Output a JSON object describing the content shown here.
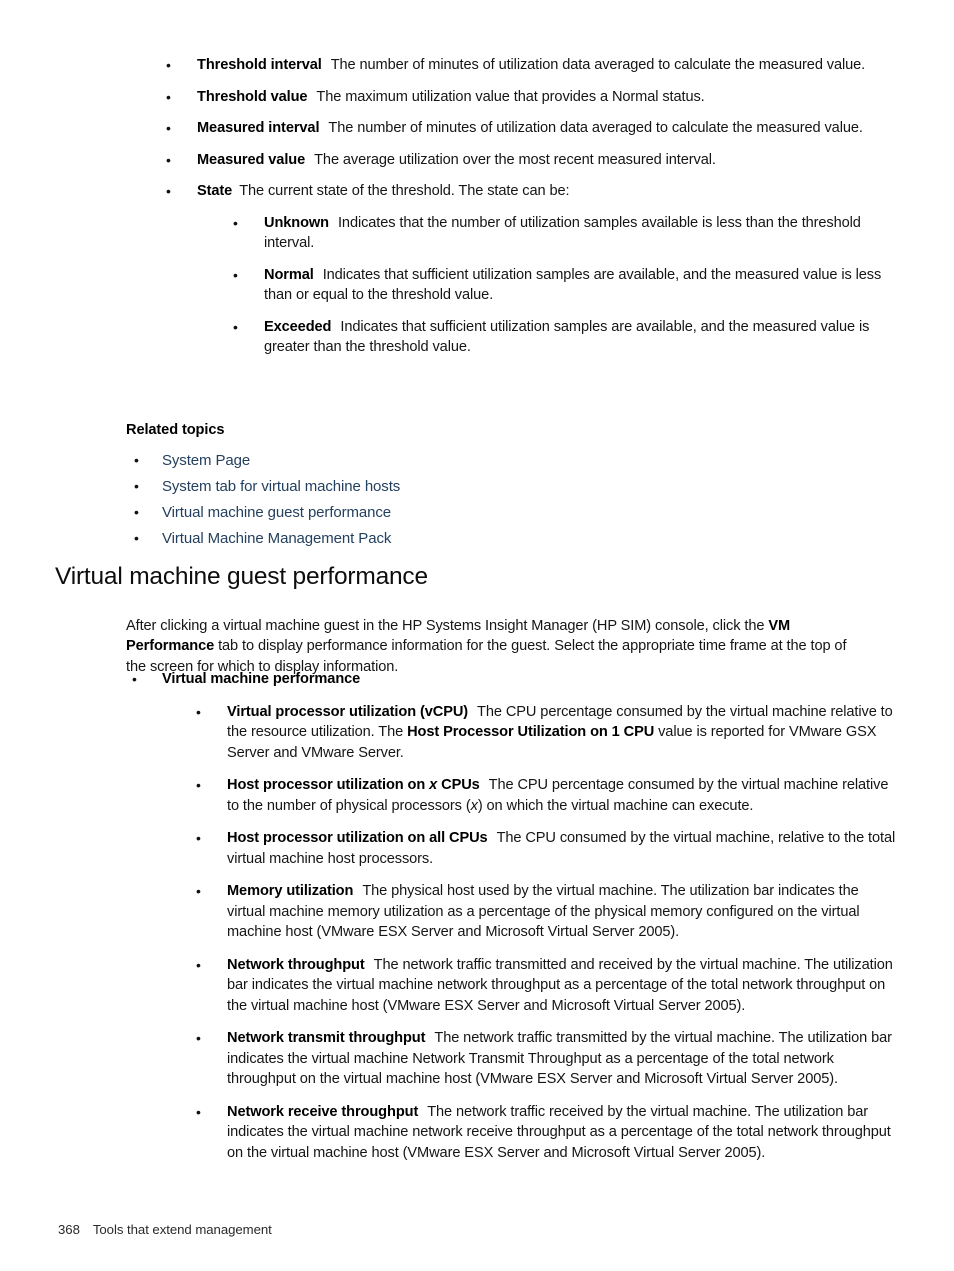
{
  "page": {
    "footer_page_number": "368",
    "footer_title": "Tools that extend management",
    "link_color": "#24405f",
    "text_color": "#151515",
    "bullet_glyph": "•"
  },
  "threshold_items": [
    {
      "term": "Threshold interval",
      "desc": "The number of minutes of utilization data averaged to calculate the measured value."
    },
    {
      "term": "Threshold value",
      "desc": "The maximum utilization value that provides a Normal status."
    },
    {
      "term": "Measured interval",
      "desc": "The number of minutes of utilization data averaged to calculate the measured value."
    },
    {
      "term": "Measured value",
      "desc": "The average utilization over the most recent measured interval."
    }
  ],
  "state_item": {
    "term": "State",
    "desc": "The current state of the threshold. The state can be:",
    "states": [
      {
        "term": "Unknown",
        "desc": "Indicates that the number of utilization samples available is less than the threshold interval."
      },
      {
        "term": "Normal",
        "desc": "Indicates that sufficient utilization samples are available, and the measured value is less than or equal to the threshold value."
      },
      {
        "term": "Exceeded",
        "desc": "Indicates that sufficient utilization samples are available, and the measured value is greater than the threshold value."
      }
    ]
  },
  "related_topics": {
    "heading": "Related topics",
    "links": [
      "System Page",
      "System tab for virtual machine hosts",
      "Virtual machine guest performance",
      "Virtual Machine Management Pack"
    ]
  },
  "vm_guest_section": {
    "heading": "Virtual machine guest performance",
    "intro": {
      "part1": "After clicking a virtual machine guest in the HP Systems Insight Manager (HP SIM) console, click the ",
      "bold1": "VM Performance",
      "part2": " tab to display performance information for the guest. Select the appropriate time frame at the top of the screen for which to display information."
    },
    "performance_heading": "Virtual machine performance",
    "metrics": [
      {
        "term": "Virtual processor utilization (vCPU)",
        "desc_part1": "The CPU percentage consumed by the virtual machine relative to the resource utilization. The ",
        "desc_bold": "Host Processor Utilization on 1 CPU",
        "desc_part2": " value is reported for VMware GSX Server and VMware Server."
      },
      {
        "term_part1": "Host processor utilization on ",
        "term_italic": "x",
        "term_part2": " CPUs",
        "desc_part1": "The CPU percentage consumed by the virtual machine relative to the number of physical processors (",
        "desc_italic": "x",
        "desc_part2": ") on which the virtual machine can execute."
      },
      {
        "term": "Host processor utilization on all CPUs",
        "desc": "The CPU consumed by the virtual machine, relative to the total virtual machine host processors."
      },
      {
        "term": "Memory utilization",
        "desc": "The physical host used by the virtual machine. The utilization bar indicates the virtual machine memory utilization as a percentage of the physical memory configured on the virtual machine host (VMware ESX Server and Microsoft Virtual Server 2005)."
      },
      {
        "term": "Network throughput",
        "desc": "The network traffic transmitted and received by the virtual machine. The utilization bar indicates the virtual machine network throughput as a percentage of the total network throughput on the virtual machine host (VMware ESX Server and Microsoft Virtual Server 2005)."
      },
      {
        "term": "Network transmit throughput",
        "desc": "The network traffic transmitted by the virtual machine. The utilization bar indicates the virtual machine Network Transmit Throughput as a percentage of the total network throughput on the virtual machine host (VMware ESX Server and Microsoft Virtual Server 2005)."
      },
      {
        "term": "Network receive throughput",
        "desc": "The network traffic received by the virtual machine. The utilization bar indicates the virtual machine network receive throughput as a percentage of the total network throughput on the virtual machine host (VMware ESX Server and Microsoft Virtual Server 2005)."
      }
    ]
  }
}
